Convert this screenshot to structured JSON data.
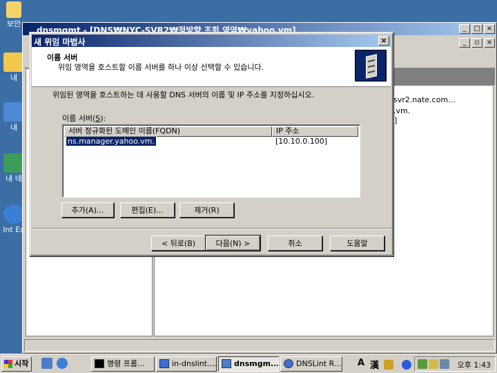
{
  "desktop": {
    "icons": [
      {
        "label": "보안",
        "color": "#f5d36b"
      },
      {
        "label": "내",
        "color": "#f2c94c"
      },
      {
        "label": "내",
        "color": "#4c8ad6"
      },
      {
        "label": "내 네",
        "color": "#3c9c5a"
      },
      {
        "label": "Int Ex",
        "color": "#3b7fd4"
      }
    ]
  },
  "mmc": {
    "title": "dnsmgmt - [DNS₩NYC-SVR2₩정방향 조회 영역₩yahoo.vm]",
    "right_items": [
      "svr2.nate.com...",
      ".vm.",
      "0]"
    ]
  },
  "dialog": {
    "title": "새 위임 마법사",
    "close": "×",
    "header_title": "이름 서버",
    "header_subtitle": "위임 영역을 호스트할 이름 서버를 하나 이상 선택할 수 있습니다.",
    "instruction": "위임된 영역을 호스트하는 데 사용할 DNS 서버의 이름 및 IP 주소를 지정하십시오.",
    "list_label_pre": "이름 서버(",
    "list_label_key": "S",
    "list_label_post": "):",
    "columns": [
      "서버 정규화된 도메인 이름(FQDN)",
      "IP 주소"
    ],
    "rows": [
      {
        "fqdn": "ns.manager.yahoo.vm.",
        "ip": "[10.10.0.100]"
      }
    ],
    "buttons": {
      "add": "추가(A)...",
      "edit": "편집(E)...",
      "remove": "제거(R)",
      "back": "< 뒤로(B)",
      "next": "다음(N) >",
      "cancel": "취소",
      "help": "도움말"
    }
  },
  "taskbar": {
    "start": "시작",
    "tasks": [
      {
        "label": "명령 프롬...",
        "icon_color": "#000000"
      },
      {
        "label": "in-dnslint....",
        "icon_color": "#3b6fd4"
      },
      {
        "label": "dnsmgm...",
        "icon_color": "#4a7fc7",
        "active": true
      },
      {
        "label": "DNSLint R...",
        "icon_color": "#3b6fd4"
      }
    ],
    "ime": [
      "A",
      "漢"
    ],
    "clock": "오후 1:43"
  }
}
